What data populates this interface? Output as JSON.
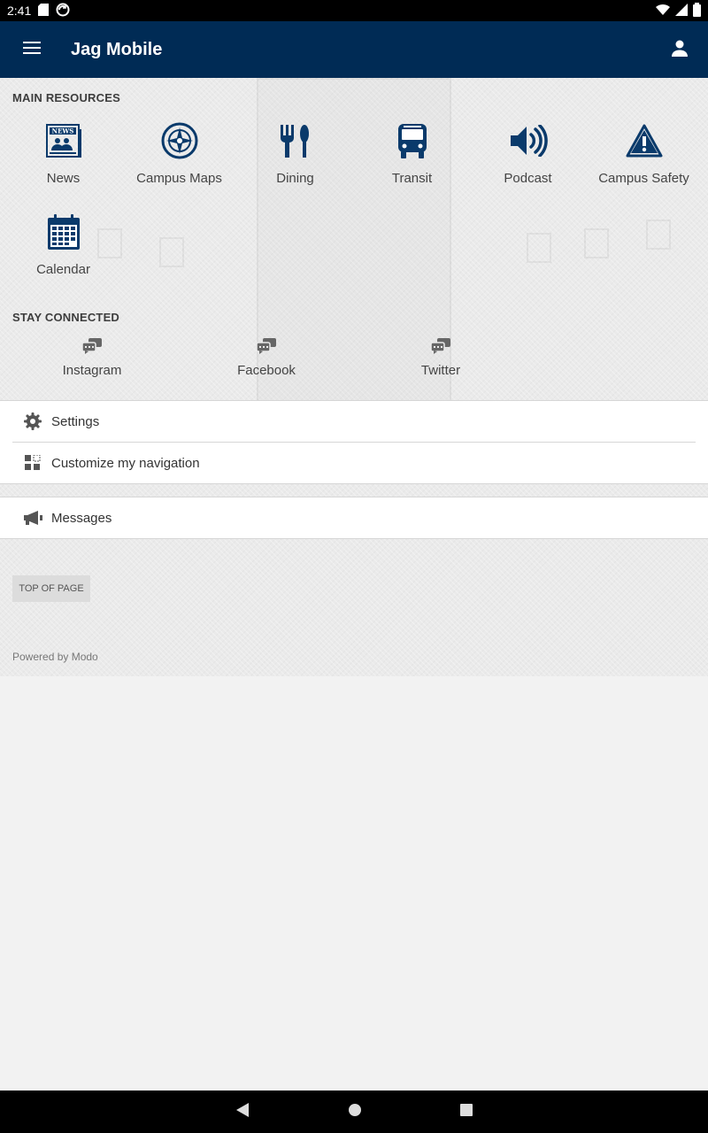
{
  "status_bar": {
    "time": "2:41"
  },
  "app_bar": {
    "title": "Jag Mobile"
  },
  "main_resources": {
    "title": "MAIN RESOURCES",
    "items": [
      {
        "label": "News",
        "icon": "news-icon"
      },
      {
        "label": "Campus Maps",
        "icon": "compass-icon"
      },
      {
        "label": "Dining",
        "icon": "fork-knife-icon"
      },
      {
        "label": "Transit",
        "icon": "bus-icon"
      },
      {
        "label": "Podcast",
        "icon": "speaker-icon"
      },
      {
        "label": "Campus Safety",
        "icon": "warning-icon"
      },
      {
        "label": "Calendar",
        "icon": "calendar-icon"
      }
    ]
  },
  "stay_connected": {
    "title": "STAY CONNECTED",
    "items": [
      {
        "label": "Instagram",
        "icon": "chat-bubbles-icon"
      },
      {
        "label": "Facebook",
        "icon": "chat-bubbles-icon"
      },
      {
        "label": "Twitter",
        "icon": "chat-bubbles-icon"
      }
    ]
  },
  "settings_list": [
    {
      "label": "Settings",
      "icon": "gear-icon"
    },
    {
      "label": "Customize my navigation",
      "icon": "grid-icon"
    }
  ],
  "messages_list": [
    {
      "label": "Messages",
      "icon": "megaphone-icon"
    }
  ],
  "footer": {
    "top_of_page": "TOP OF PAGE",
    "powered_by": "Powered by Modo"
  },
  "colors": {
    "brand": "#002b55",
    "icon": "#0a3a6b"
  }
}
